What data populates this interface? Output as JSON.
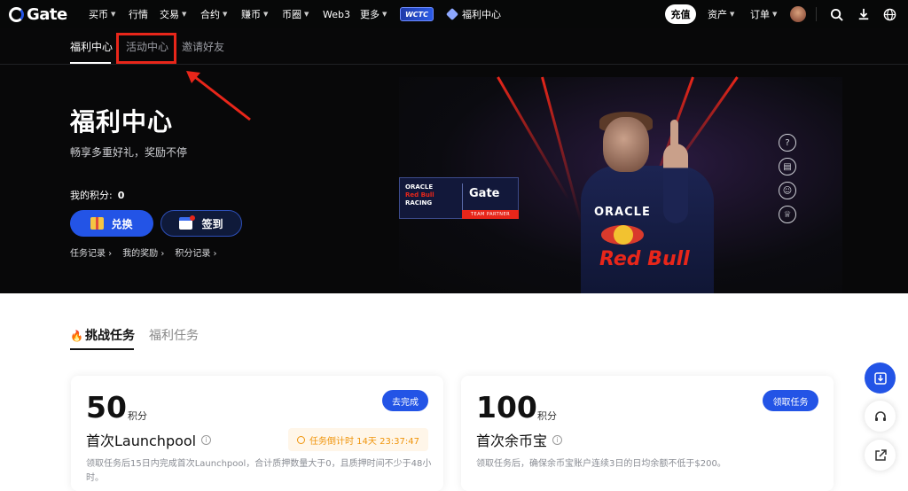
{
  "topbar": {
    "logo": "Gate",
    "nav": [
      {
        "label": "买币",
        "caret": true
      },
      {
        "label": "行情",
        "caret": false
      },
      {
        "label": "交易",
        "caret": true
      },
      {
        "label": "合约",
        "caret": true
      },
      {
        "label": "赚币",
        "caret": true
      },
      {
        "label": "币圈",
        "caret": true
      },
      {
        "label": "Web3",
        "caret": false
      },
      {
        "label": "更多",
        "caret": true
      }
    ],
    "wctc_badge": "WCTC",
    "welfare_link": "福利中心",
    "deposit_label": "充值",
    "assets_label": "资产",
    "orders_label": "订单"
  },
  "hero": {
    "subtabs": [
      "福利中心",
      "活动中心",
      "邀请好友"
    ],
    "title": "福利中心",
    "subtitle": "畅享多重好礼，奖励不停",
    "points_label": "我的积分:",
    "points_value": "0",
    "redeem_label": "兑换",
    "checkin_label": "签到",
    "links": [
      "任务记录 ›",
      "我的奖励 ›",
      "积分记录 ›"
    ],
    "banner": {
      "partner_line1": "ORACLE",
      "partner_line2": "Red Bull",
      "partner_line3": "RACING",
      "partner_brand": "Gate",
      "partner_tag": "TEAM PARTNER",
      "suit_text": "ORACLE",
      "suit_brand": "Red Bull"
    }
  },
  "tasks": {
    "tabs": [
      "挑战任务",
      "福利任务"
    ],
    "cards": [
      {
        "points": "50",
        "unit": "积分",
        "title": "首次Launchpool",
        "button": "去完成",
        "timer": "任务倒计时 14天 23:37:47",
        "desc": "领取任务后15日内完成首次Launchpool，合计质押数量大于0，且质押时间不少于48小时。"
      },
      {
        "points": "100",
        "unit": "积分",
        "title": "首次余币宝",
        "button": "领取任务",
        "desc": "领取任务后，确保余币宝账户连续3日的日均余额不低于$200。"
      }
    ]
  },
  "colors": {
    "accent": "#2354e6",
    "highlight": "#e8261a",
    "timer": "#f0940a"
  }
}
